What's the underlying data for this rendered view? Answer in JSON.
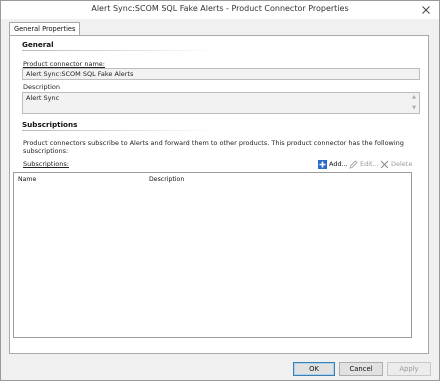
{
  "window": {
    "title": "Alert Sync:SCOM SQL Fake Alerts - Product Connector Properties"
  },
  "tabs": [
    {
      "label": "General Properties"
    }
  ],
  "general": {
    "heading": "General",
    "name_label": "Product connector name:",
    "name_value": "Alert Sync:SCOM SQL Fake Alerts",
    "description_label": "Description",
    "description_value": "Alert Sync"
  },
  "subscriptions": {
    "heading": "Subscriptions",
    "info_text": "Product connectors subscribe to Alerts and forward them to other products. This product connector has the following subscriptions:",
    "list_label": "Subscriptions:",
    "toolbar": {
      "add": "Add...",
      "edit": "Edit...",
      "delete": "Delete"
    },
    "columns": [
      "Name",
      "Description"
    ],
    "rows": []
  },
  "buttons": {
    "ok": "OK",
    "cancel": "Cancel",
    "apply": "Apply"
  },
  "colors": {
    "add_icon": "#2b6cc4",
    "accent": "#3c7fb1"
  }
}
